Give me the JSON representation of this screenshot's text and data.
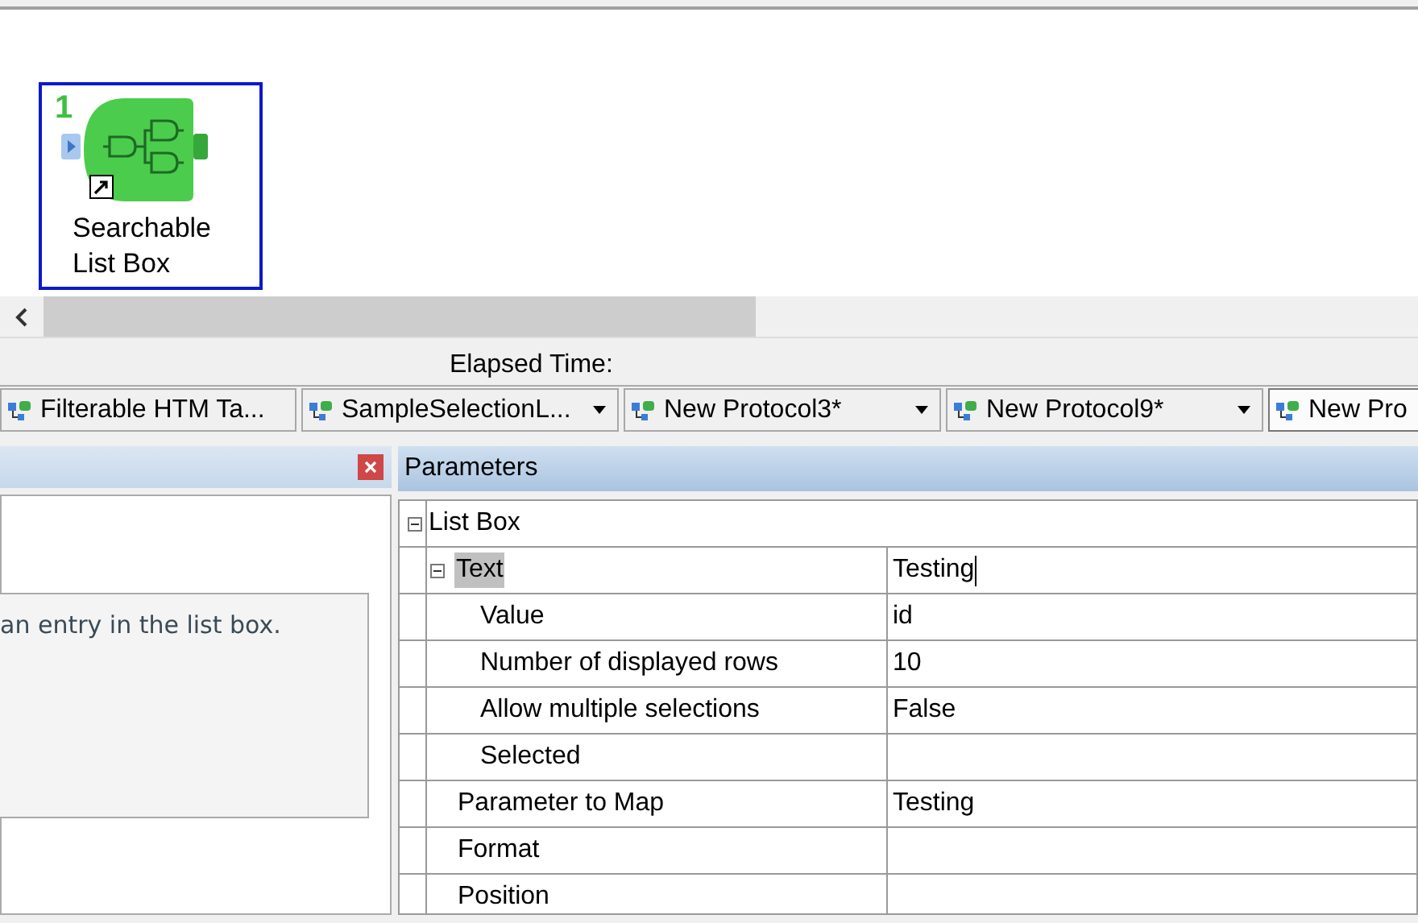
{
  "canvas": {
    "nodes": [
      {
        "number": "1",
        "label": "Searchable\nList Box",
        "selected": true
      }
    ]
  },
  "status": {
    "elapsed_label": "Elapsed Time:"
  },
  "tabs": [
    {
      "label": "Filterable HTM Ta...",
      "has_menu": false,
      "selected": false
    },
    {
      "label": "SampleSelectionL...",
      "has_menu": true,
      "selected": false
    },
    {
      "label": "New Protocol3*",
      "has_menu": true,
      "selected": false
    },
    {
      "label": "New Protocol9*",
      "has_menu": true,
      "selected": false
    },
    {
      "label": "New Pro",
      "has_menu": false,
      "selected": true
    }
  ],
  "help_panel": {
    "description": "an entry in the list box."
  },
  "parameters": {
    "title": "Parameters",
    "properties": [
      {
        "name": "List Box",
        "kind": "category",
        "expanded": true,
        "children": [
          {
            "name": "Text",
            "value": "Testing",
            "expanded": true,
            "selected": true,
            "editing": true,
            "children": [
              {
                "name": "Value",
                "value": "id",
                "selected": false
              },
              {
                "name": "Number of displayed rows",
                "value": "10",
                "selected": false
              },
              {
                "name": "Allow multiple selections",
                "value": "False",
                "selected": false
              },
              {
                "name": "Selected",
                "selected": false
              }
            ]
          },
          {
            "name": "Parameter to Map",
            "value": "Testing",
            "selected": false
          },
          {
            "name": "Format",
            "selected": false
          },
          {
            "name": "Position",
            "selected": false
          }
        ]
      }
    ]
  }
}
